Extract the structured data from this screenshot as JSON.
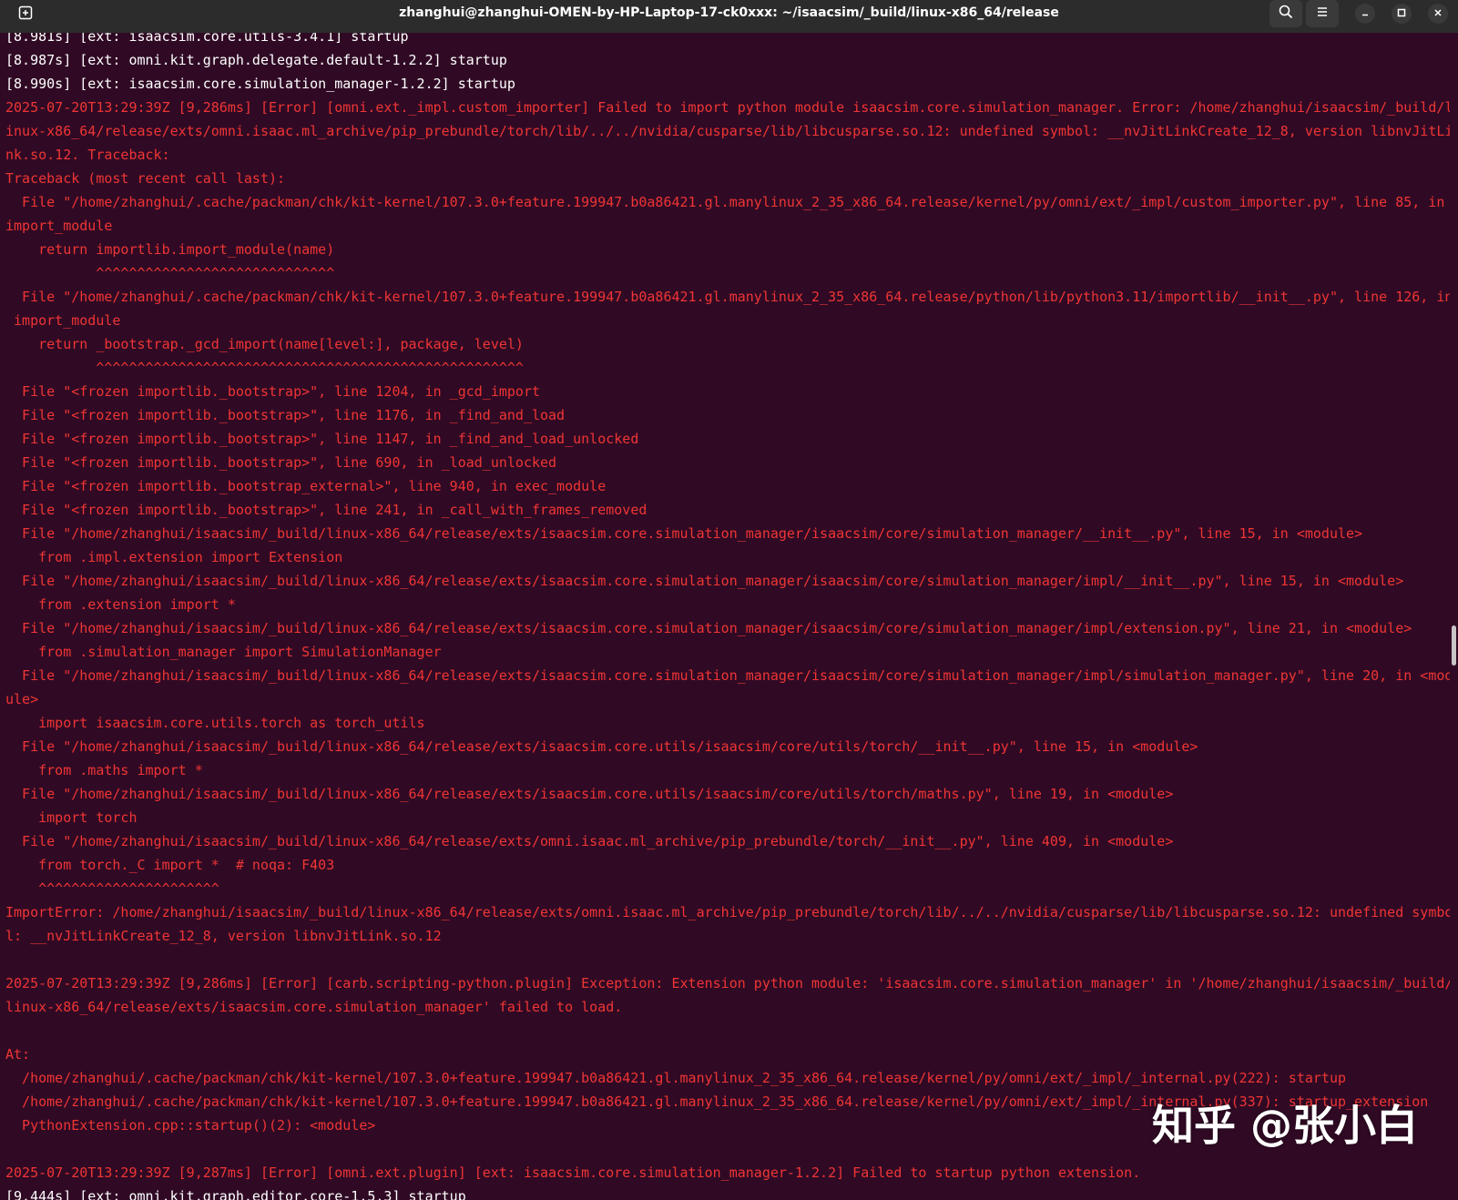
{
  "window": {
    "title": "zhanghui@zhanghui-OMEN-by-HP-Laptop-17-ck0xxx: ~/isaacsim/_build/linux-x86_64/release"
  },
  "titlebar": {
    "new_tab_icon": "new-tab-icon",
    "search_icon": "search-icon",
    "menu_icon": "hamburger-menu-icon",
    "minimize_icon": "minimize-icon",
    "maximize_icon": "maximize-icon",
    "close_icon": "close-icon"
  },
  "colors": {
    "background": "#300a24",
    "error_text": "#ef3535",
    "normal_text": "#ffffff",
    "titlebar": "#2c2c2c"
  },
  "terminal": {
    "lines": [
      {
        "text": "[8.981s] [ext: isaacsim.core.utils-3.4.1] startup",
        "style": "white"
      },
      {
        "text": "[8.987s] [ext: omni.kit.graph.delegate.default-1.2.2] startup",
        "style": "white"
      },
      {
        "text": "[8.990s] [ext: isaacsim.core.simulation_manager-1.2.2] startup",
        "style": "white"
      },
      {
        "text": "2025-07-20T13:29:39Z [9,286ms] [Error] [omni.ext._impl.custom_importer] Failed to import python module isaacsim.core.simulation_manager. Error: /home/zhanghui/isaacsim/_build/l",
        "style": "error"
      },
      {
        "text": "inux-x86_64/release/exts/omni.isaac.ml_archive/pip_prebundle/torch/lib/../../nvidia/cusparse/lib/libcusparse.so.12: undefined symbol: __nvJitLinkCreate_12_8, version libnvJitLi",
        "style": "error"
      },
      {
        "text": "nk.so.12. Traceback:",
        "style": "error"
      },
      {
        "text": "Traceback (most recent call last):",
        "style": "error"
      },
      {
        "text": "  File \"/home/zhanghui/.cache/packman/chk/kit-kernel/107.3.0+feature.199947.b0a86421.gl.manylinux_2_35_x86_64.release/kernel/py/omni/ext/_impl/custom_importer.py\", line 85, in",
        "style": "error"
      },
      {
        "text": "import_module",
        "style": "error"
      },
      {
        "text": "    return importlib.import_module(name)",
        "style": "error"
      },
      {
        "text": "           ^^^^^^^^^^^^^^^^^^^^^^^^^^^^^",
        "style": "error"
      },
      {
        "text": "  File \"/home/zhanghui/.cache/packman/chk/kit-kernel/107.3.0+feature.199947.b0a86421.gl.manylinux_2_35_x86_64.release/python/lib/python3.11/importlib/__init__.py\", line 126, in",
        "style": "error"
      },
      {
        "text": " import_module",
        "style": "error"
      },
      {
        "text": "    return _bootstrap._gcd_import(name[level:], package, level)",
        "style": "error"
      },
      {
        "text": "           ^^^^^^^^^^^^^^^^^^^^^^^^^^^^^^^^^^^^^^^^^^^^^^^^^^^^",
        "style": "error"
      },
      {
        "text": "  File \"<frozen importlib._bootstrap>\", line 1204, in _gcd_import",
        "style": "error"
      },
      {
        "text": "  File \"<frozen importlib._bootstrap>\", line 1176, in _find_and_load",
        "style": "error"
      },
      {
        "text": "  File \"<frozen importlib._bootstrap>\", line 1147, in _find_and_load_unlocked",
        "style": "error"
      },
      {
        "text": "  File \"<frozen importlib._bootstrap>\", line 690, in _load_unlocked",
        "style": "error"
      },
      {
        "text": "  File \"<frozen importlib._bootstrap_external>\", line 940, in exec_module",
        "style": "error"
      },
      {
        "text": "  File \"<frozen importlib._bootstrap>\", line 241, in _call_with_frames_removed",
        "style": "error"
      },
      {
        "text": "  File \"/home/zhanghui/isaacsim/_build/linux-x86_64/release/exts/isaacsim.core.simulation_manager/isaacsim/core/simulation_manager/__init__.py\", line 15, in <module>",
        "style": "error"
      },
      {
        "text": "    from .impl.extension import Extension",
        "style": "error"
      },
      {
        "text": "  File \"/home/zhanghui/isaacsim/_build/linux-x86_64/release/exts/isaacsim.core.simulation_manager/isaacsim/core/simulation_manager/impl/__init__.py\", line 15, in <module>",
        "style": "error"
      },
      {
        "text": "    from .extension import *",
        "style": "error"
      },
      {
        "text": "  File \"/home/zhanghui/isaacsim/_build/linux-x86_64/release/exts/isaacsim.core.simulation_manager/isaacsim/core/simulation_manager/impl/extension.py\", line 21, in <module>",
        "style": "error"
      },
      {
        "text": "    from .simulation_manager import SimulationManager",
        "style": "error"
      },
      {
        "text": "  File \"/home/zhanghui/isaacsim/_build/linux-x86_64/release/exts/isaacsim.core.simulation_manager/isaacsim/core/simulation_manager/impl/simulation_manager.py\", line 20, in <mod",
        "style": "error"
      },
      {
        "text": "ule>",
        "style": "error"
      },
      {
        "text": "    import isaacsim.core.utils.torch as torch_utils",
        "style": "error"
      },
      {
        "text": "  File \"/home/zhanghui/isaacsim/_build/linux-x86_64/release/exts/isaacsim.core.utils/isaacsim/core/utils/torch/__init__.py\", line 15, in <module>",
        "style": "error"
      },
      {
        "text": "    from .maths import *",
        "style": "error"
      },
      {
        "text": "  File \"/home/zhanghui/isaacsim/_build/linux-x86_64/release/exts/isaacsim.core.utils/isaacsim/core/utils/torch/maths.py\", line 19, in <module>",
        "style": "error"
      },
      {
        "text": "    import torch",
        "style": "error"
      },
      {
        "text": "  File \"/home/zhanghui/isaacsim/_build/linux-x86_64/release/exts/omni.isaac.ml_archive/pip_prebundle/torch/__init__.py\", line 409, in <module>",
        "style": "error"
      },
      {
        "text": "    from torch._C import *  # noqa: F403",
        "style": "error"
      },
      {
        "text": "    ^^^^^^^^^^^^^^^^^^^^^^",
        "style": "error"
      },
      {
        "text": "ImportError: /home/zhanghui/isaacsim/_build/linux-x86_64/release/exts/omni.isaac.ml_archive/pip_prebundle/torch/lib/../../nvidia/cusparse/lib/libcusparse.so.12: undefined symbo",
        "style": "error"
      },
      {
        "text": "l: __nvJitLinkCreate_12_8, version libnvJitLink.so.12",
        "style": "error"
      },
      {
        "text": "",
        "style": "error"
      },
      {
        "text": "2025-07-20T13:29:39Z [9,286ms] [Error] [carb.scripting-python.plugin] Exception: Extension python module: 'isaacsim.core.simulation_manager' in '/home/zhanghui/isaacsim/_build/",
        "style": "error"
      },
      {
        "text": "linux-x86_64/release/exts/isaacsim.core.simulation_manager' failed to load.",
        "style": "error"
      },
      {
        "text": "",
        "style": "error"
      },
      {
        "text": "At:",
        "style": "error"
      },
      {
        "text": "  /home/zhanghui/.cache/packman/chk/kit-kernel/107.3.0+feature.199947.b0a86421.gl.manylinux_2_35_x86_64.release/kernel/py/omni/ext/_impl/_internal.py(222): startup",
        "style": "error"
      },
      {
        "text": "  /home/zhanghui/.cache/packman/chk/kit-kernel/107.3.0+feature.199947.b0a86421.gl.manylinux_2_35_x86_64.release/kernel/py/omni/ext/_impl/_internal.py(337): startup_extension",
        "style": "error"
      },
      {
        "text": "  PythonExtension.cpp::startup()(2): <module>",
        "style": "error"
      },
      {
        "text": "",
        "style": "error"
      },
      {
        "text": "2025-07-20T13:29:39Z [9,287ms] [Error] [omni.ext.plugin] [ext: isaacsim.core.simulation_manager-1.2.2] Failed to startup python extension.",
        "style": "error"
      },
      {
        "text": "[9.444s] [ext: omni.kit.graph.editor.core-1.5.3] startup",
        "style": "white"
      }
    ]
  },
  "watermark": {
    "text": "知乎 @张小白"
  }
}
